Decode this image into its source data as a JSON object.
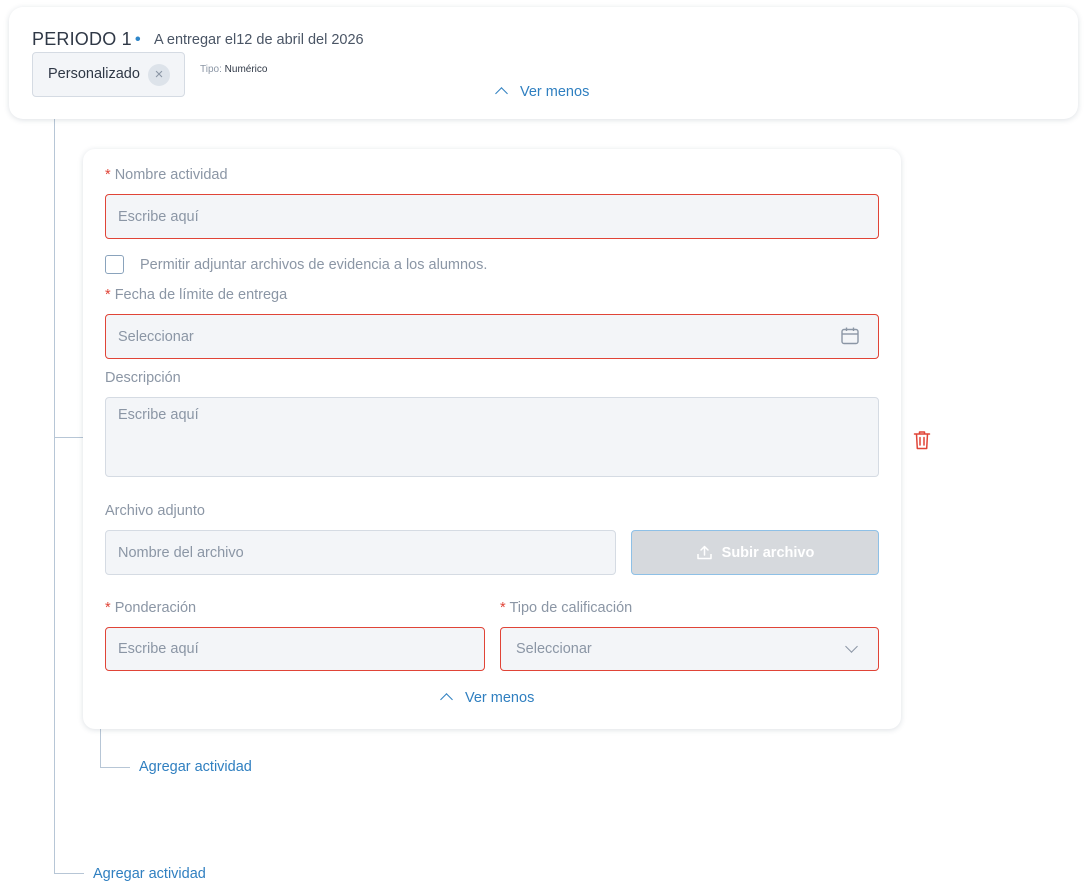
{
  "period": {
    "title": "PERIODO 1",
    "separator": "•",
    "due_text": "A entregar el12 de abril del 2026",
    "chip_label": "Personalizado",
    "chip_remove": "×",
    "type_label": "Tipo:",
    "type_value": "Numérico",
    "toggle_label": "Ver menos"
  },
  "activity": {
    "name_label": "Nombre actividad",
    "name_placeholder": "Escribe aquí",
    "allow_files_label": "Permitir adjuntar archivos de evidencia a los alumnos.",
    "deadline_label": "Fecha de límite de entrega",
    "deadline_placeholder": "Seleccionar",
    "description_label": "Descripción",
    "description_placeholder": "Escribe aquí",
    "attachment_label": "Archivo adjunto",
    "attachment_placeholder": "Nombre del archivo",
    "upload_button": "Subir archivo",
    "weight_label": "Ponderación",
    "weight_placeholder": "Escribe aquí",
    "grade_type_label": "Tipo de calificación",
    "grade_type_placeholder": "Seleccionar",
    "toggle_label": "Ver menos",
    "required_mark": "*"
  },
  "links": {
    "add_activity_inner": "Agregar actividad",
    "add_activity_outer": "Agregar actividad"
  },
  "colors": {
    "accent": "#2f7fc0",
    "error": "#e04437",
    "field_bg": "#f3f5f8"
  },
  "icons": [
    "close-icon",
    "chevron-up-icon",
    "calendar-icon",
    "upload-icon",
    "chevron-down-icon",
    "trash-icon"
  ]
}
